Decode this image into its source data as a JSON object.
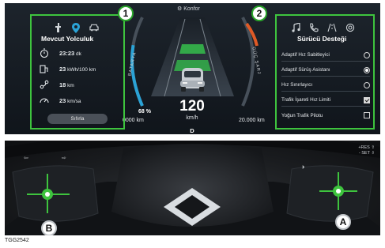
{
  "cluster": {
    "mode_label": "Konfor",
    "trip_panel": {
      "callout": "1",
      "tab_icons": [
        "wrench-icon",
        "location-pin-icon",
        "car-icon"
      ],
      "title": "Mevcut Yolculuk",
      "rows": [
        {
          "icon": "stopwatch-icon",
          "value": "23:23",
          "unit": "dk"
        },
        {
          "icon": "energy-consumption-icon",
          "value": "23",
          "unit": "kWh/100 km"
        },
        {
          "icon": "route-icon",
          "value": "18",
          "unit": "km"
        },
        {
          "icon": "speedometer-icon",
          "value": "23",
          "unit": "km/sa"
        }
      ],
      "reset_label": "Sıfırla"
    },
    "center": {
      "battery_label": "BATARYA",
      "battery_percent": "68 %",
      "battery_range": "0000 km",
      "speed": "120",
      "speed_unit": "km/h",
      "gear": "D",
      "power_label": "GÜÇ  ŞARJ",
      "total_range": "20.000 km",
      "battery_level": 0.68
    },
    "assist_panel": {
      "callout": "2",
      "tab_icons": [
        "music-note-icon",
        "phone-icon",
        "road-icon",
        "settings-icon"
      ],
      "title": "Sürücü Desteği",
      "rows": [
        {
          "label": "Adaptif Hız Sabitleyici",
          "control": "radio",
          "checked": false
        },
        {
          "label": "Adaptif Sürüş Asistanı",
          "control": "radio",
          "checked": true
        },
        {
          "label": "Hız Sınırlayıcı",
          "control": "radio",
          "checked": false
        },
        {
          "label": "Trafik İşareti Hız Limiti",
          "control": "checkbox",
          "checked": true
        },
        {
          "label": "Yoğun Trafik Pilotu",
          "control": "checkbox",
          "checked": false
        }
      ]
    }
  },
  "steering": {
    "left_label": "B",
    "right_label": "A",
    "right_top_labels": [
      "+RES ⇧",
      "- SET ⇩"
    ],
    "figure_code": "TGG2542"
  },
  "colors": {
    "highlight": "#3ec43e",
    "battery_arc": "#2ba3d6",
    "power_arc": "#e05a26",
    "lane_green": "#34b04a"
  }
}
